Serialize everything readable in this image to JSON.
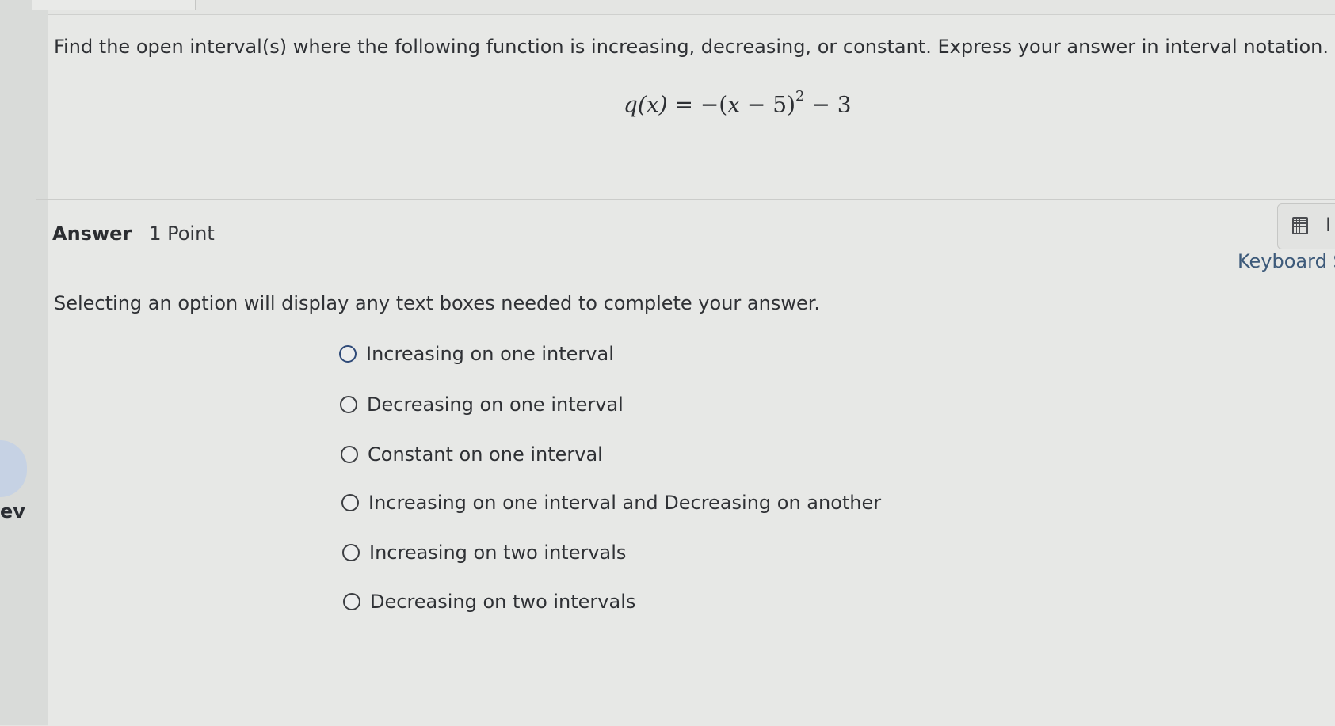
{
  "question": {
    "prompt": "Find the open interval(s) where the following function is increasing, decreasing, or constant. Express your answer in interval notation.",
    "formula": {
      "lhs": "q(x)",
      "eq": " = −(",
      "var": "x",
      "rest": " − 5)",
      "exp": "2",
      "tail": " − 3"
    }
  },
  "answer": {
    "heading": "Answer",
    "points": "1 Point",
    "instruction": "Selecting an option will display any text boxes needed to complete your answer.",
    "options": [
      {
        "label": "Increasing on one interval"
      },
      {
        "label": "Decreasing on one interval"
      },
      {
        "label": "Constant on one interval"
      },
      {
        "label": "Increasing on one interval and Decreasing on another"
      },
      {
        "label": "Increasing on two intervals"
      },
      {
        "label": "Decreasing on two intervals"
      }
    ]
  },
  "tools": {
    "calculator_icon": "calculator-icon",
    "letter": "I",
    "keyboard_label": "Keyboard S"
  },
  "nav": {
    "left_text": "ev"
  }
}
